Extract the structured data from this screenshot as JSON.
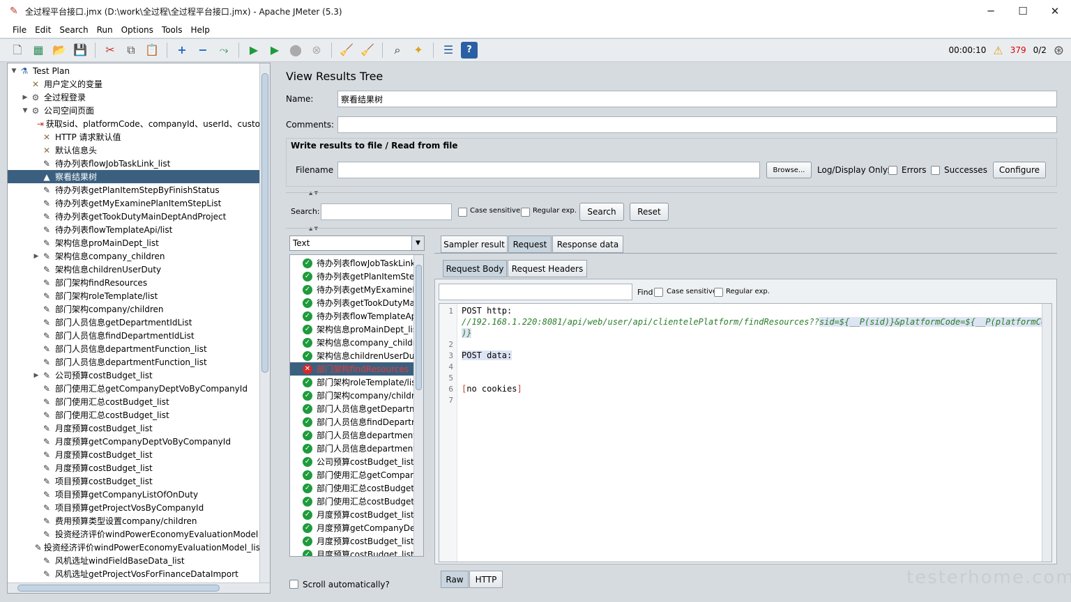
{
  "window": {
    "title": "全过程平台接口.jmx (D:\\work\\全过程\\全过程平台接口.jmx) - Apache JMeter (5.3)",
    "minimize": "─",
    "maximize": "☐",
    "close": "✕"
  },
  "menu": [
    "File",
    "Edit",
    "Search",
    "Run",
    "Options",
    "Tools",
    "Help"
  ],
  "toolbar_right": {
    "elapsed": "00:00:10",
    "warnings": "379",
    "threads": "0/2"
  },
  "tree": [
    {
      "label": "Test Plan",
      "level": 0,
      "tw": "▼",
      "icon": "test-plan-icon"
    },
    {
      "label": "用户定义的变量",
      "level": 1,
      "tw": "",
      "icon": "config-icon"
    },
    {
      "label": "全过程登录",
      "level": 1,
      "tw": "▶",
      "icon": "thread-group-icon"
    },
    {
      "label": "公司空间页面",
      "level": 1,
      "tw": "▼",
      "icon": "thread-group-icon"
    },
    {
      "label": "获取sid、platformCode、companyId、userId、custo",
      "level": 2,
      "tw": "",
      "icon": "sampler-icon"
    },
    {
      "label": "HTTP 请求默认值",
      "level": 2,
      "tw": "",
      "icon": "config-icon"
    },
    {
      "label": "默认信息头",
      "level": 2,
      "tw": "",
      "icon": "config-icon"
    },
    {
      "label": "待办列表flowJobTaskLink_list",
      "level": 2,
      "tw": "",
      "icon": "pencil-icon"
    },
    {
      "label": "察看结果树",
      "level": 2,
      "tw": "",
      "icon": "listener-icon",
      "selected": true
    },
    {
      "label": "待办列表getPlanItemStepByFinishStatus",
      "level": 2,
      "tw": "",
      "icon": "pencil-icon"
    },
    {
      "label": "待办列表getMyExaminePlanItemStepList",
      "level": 2,
      "tw": "",
      "icon": "pencil-icon"
    },
    {
      "label": "待办列表getTookDutyMainDeptAndProject",
      "level": 2,
      "tw": "",
      "icon": "pencil-icon"
    },
    {
      "label": "待办列表flowTemplateApi/list",
      "level": 2,
      "tw": "",
      "icon": "pencil-icon"
    },
    {
      "label": "架构信息proMainDept_list",
      "level": 2,
      "tw": "",
      "icon": "pencil-icon"
    },
    {
      "label": "架构信息company_children",
      "level": 2,
      "tw": "▶",
      "icon": "pencil-icon"
    },
    {
      "label": "架构信息childrenUserDuty",
      "level": 2,
      "tw": "",
      "icon": "pencil-icon"
    },
    {
      "label": "部门架构findResources",
      "level": 2,
      "tw": "",
      "icon": "pencil-icon"
    },
    {
      "label": "部门架构roleTemplate/list",
      "level": 2,
      "tw": "",
      "icon": "pencil-icon"
    },
    {
      "label": "部门架构company/children",
      "level": 2,
      "tw": "",
      "icon": "pencil-icon"
    },
    {
      "label": "部门人员信息getDepartmentIdList",
      "level": 2,
      "tw": "",
      "icon": "pencil-icon"
    },
    {
      "label": "部门人员信息findDepartmentIdList",
      "level": 2,
      "tw": "",
      "icon": "pencil-icon"
    },
    {
      "label": "部门人员信息departmentFunction_list",
      "level": 2,
      "tw": "",
      "icon": "pencil-icon"
    },
    {
      "label": "部门人员信息departmentFunction_list",
      "level": 2,
      "tw": "",
      "icon": "pencil-icon"
    },
    {
      "label": "公司预算costBudget_list",
      "level": 2,
      "tw": "▶",
      "icon": "pencil-icon"
    },
    {
      "label": "部门使用汇总getCompanyDeptVoByCompanyId",
      "level": 2,
      "tw": "",
      "icon": "pencil-icon"
    },
    {
      "label": "部门使用汇总costBudget_list",
      "level": 2,
      "tw": "",
      "icon": "pencil-icon"
    },
    {
      "label": "部门使用汇总costBudget_list",
      "level": 2,
      "tw": "",
      "icon": "pencil-icon"
    },
    {
      "label": "月度预算costBudget_list",
      "level": 2,
      "tw": "",
      "icon": "pencil-icon"
    },
    {
      "label": "月度预算getCompanyDeptVoByCompanyId",
      "level": 2,
      "tw": "",
      "icon": "pencil-icon"
    },
    {
      "label": "月度预算costBudget_list",
      "level": 2,
      "tw": "",
      "icon": "pencil-icon"
    },
    {
      "label": "月度预算costBudget_list",
      "level": 2,
      "tw": "",
      "icon": "pencil-icon"
    },
    {
      "label": "项目预算costBudget_list",
      "level": 2,
      "tw": "",
      "icon": "pencil-icon"
    },
    {
      "label": "项目预算getCompanyListOfOnDuty",
      "level": 2,
      "tw": "",
      "icon": "pencil-icon"
    },
    {
      "label": "项目预算getProjectVosByCompanyId",
      "level": 2,
      "tw": "",
      "icon": "pencil-icon"
    },
    {
      "label": "费用预算类型设置company/children",
      "level": 2,
      "tw": "",
      "icon": "pencil-icon"
    },
    {
      "label": "投资经济评价windPowerEconomyEvaluationModel",
      "level": 2,
      "tw": "",
      "icon": "pencil-icon"
    },
    {
      "label": "投资经济评价windPowerEconomyEvaluationModel_lis",
      "level": 2,
      "tw": "",
      "icon": "pencil-icon"
    },
    {
      "label": "风机选址windFieldBaseData_list",
      "level": 2,
      "tw": "",
      "icon": "pencil-icon"
    },
    {
      "label": "风机选址getProjectVosForFinanceDataImport",
      "level": 2,
      "tw": "",
      "icon": "pencil-icon"
    }
  ],
  "panel": {
    "title": "View Results Tree",
    "name_label": "Name:",
    "name_value": "察看结果树",
    "comments_label": "Comments:",
    "comments_value": "",
    "file_group_title": "Write results to file / Read from file",
    "filename_label": "Filename",
    "filename_value": "",
    "browse": "Browse...",
    "log_display": "Log/Display Only:",
    "errors": "Errors",
    "successes": "Successes",
    "configure": "Configure",
    "search_label": "Search:",
    "search_value": "",
    "case_sensitive": "Case sensitive",
    "regular_exp": "Regular exp.",
    "search_btn": "Search",
    "reset_btn": "Reset",
    "renderer": "Text",
    "scroll_auto": "Scroll automatically?"
  },
  "results": [
    {
      "label": "待办列表flowJobTaskLink_list",
      "ok": true
    },
    {
      "label": "待办列表getPlanItemStepByFinishStatus",
      "ok": true
    },
    {
      "label": "待办列表getMyExaminePlanItemStepList",
      "ok": true
    },
    {
      "label": "待办列表getTookDutyMainDeptAndProject",
      "ok": true
    },
    {
      "label": "待办列表flowTemplateApi/list",
      "ok": true
    },
    {
      "label": "架构信息proMainDept_list",
      "ok": true
    },
    {
      "label": "架构信息company_children",
      "ok": true
    },
    {
      "label": "架构信息childrenUserDuty",
      "ok": true
    },
    {
      "label": "部门架构findResources",
      "ok": false,
      "selected": true
    },
    {
      "label": "部门架构roleTemplate/list",
      "ok": true
    },
    {
      "label": "部门架构company/children",
      "ok": true
    },
    {
      "label": "部门人员信息getDepartmentIdList",
      "ok": true
    },
    {
      "label": "部门人员信息findDepartmentIdList",
      "ok": true
    },
    {
      "label": "部门人员信息departmentFunction_list",
      "ok": true
    },
    {
      "label": "部门人员信息departmentFunction_list",
      "ok": true
    },
    {
      "label": "公司预算costBudget_list",
      "ok": true
    },
    {
      "label": "部门使用汇总getCompanyDeptVoByCompanyId",
      "ok": true
    },
    {
      "label": "部门使用汇总costBudget_list",
      "ok": true
    },
    {
      "label": "部门使用汇总costBudget_list",
      "ok": true
    },
    {
      "label": "月度预算costBudget_list",
      "ok": true
    },
    {
      "label": "月度预算getCompanyDeptVoByCompanyId",
      "ok": true
    },
    {
      "label": "月度预算costBudget_list",
      "ok": true
    },
    {
      "label": "月度预算costBudget_list",
      "ok": true
    }
  ],
  "tabs": {
    "sampler": "Sampler result",
    "request": "Request",
    "response": "Response data"
  },
  "subtabs": {
    "body": "Request Body",
    "headers": "Request Headers"
  },
  "find": {
    "label": "Find",
    "case": "Case sensitive",
    "regex": "Regular exp.",
    "value": ""
  },
  "code": {
    "l1": "POST http:",
    "l1b": "//192.168.1.220:8081/api/web/user/api/clientelePlatform/findResources??",
    "l1c": "sid=${__P(sid)}&platformCode=${__P(platformCode",
    "l1d": ")}",
    "l3": "POST data:",
    "l6a": "[",
    "l6b": "no cookies",
    "l6c": "]"
  },
  "bottom_tabs": {
    "raw": "Raw",
    "http": "HTTP"
  },
  "watermark": "testerhome.com"
}
